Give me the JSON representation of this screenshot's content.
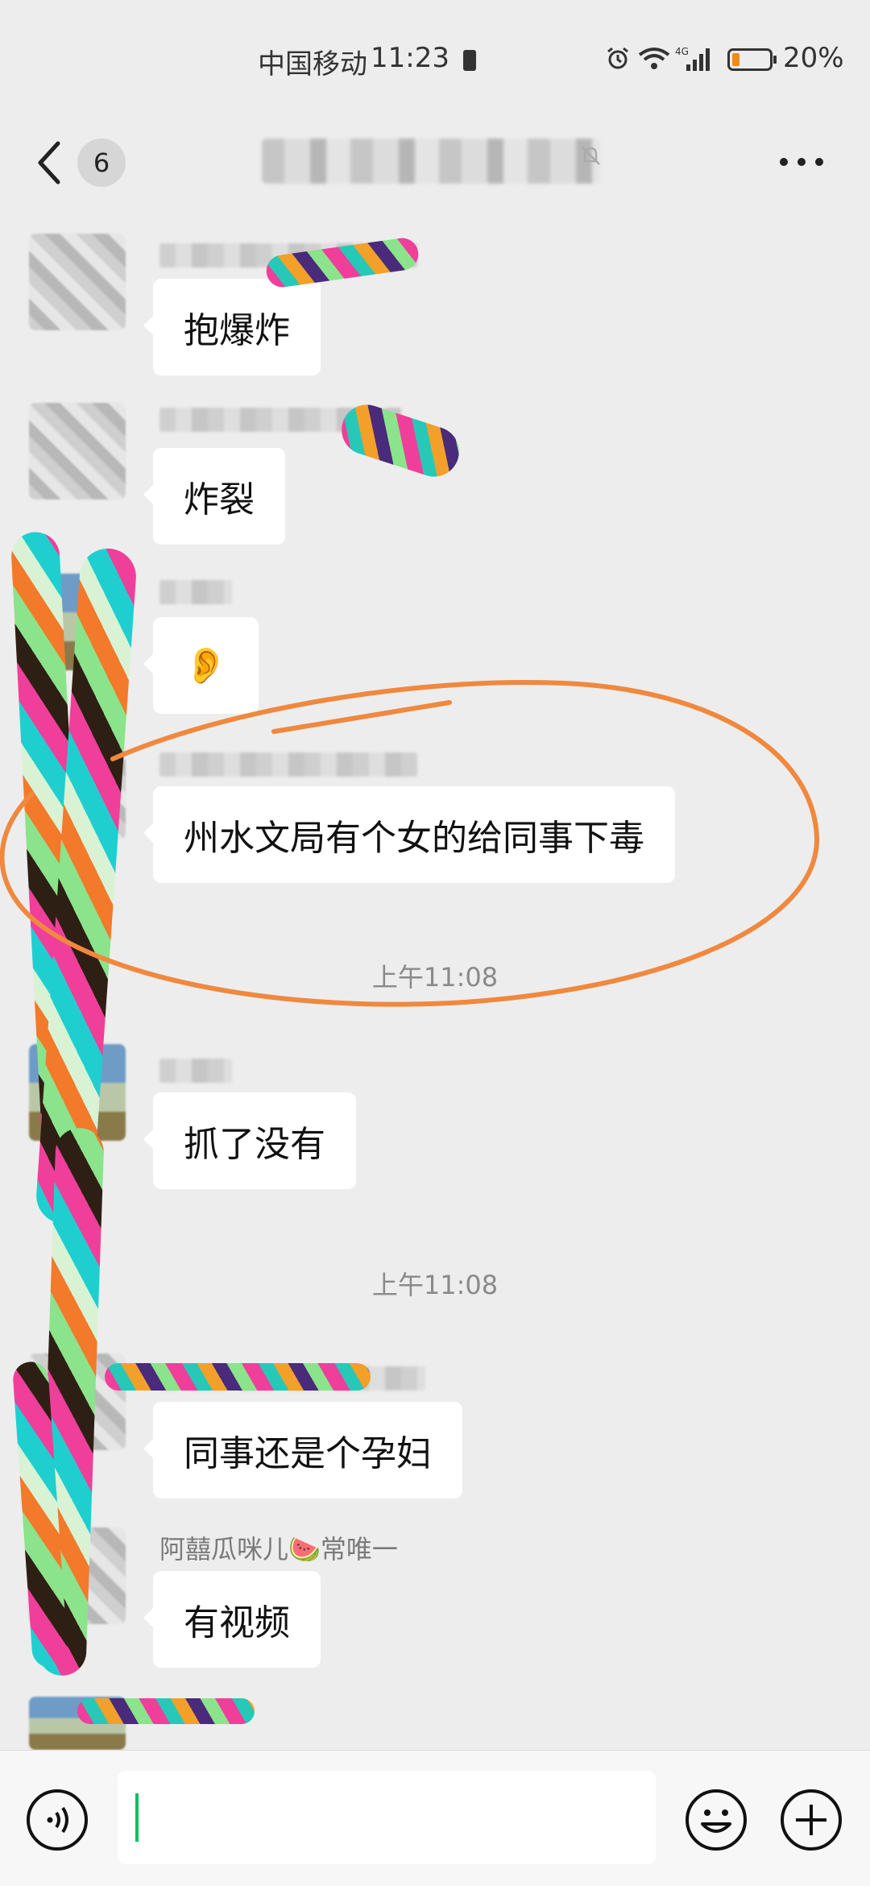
{
  "status_bar": {
    "carrier": "中国移动",
    "time": "11:23",
    "network": "4G",
    "battery_percent": "20%",
    "battery_level": 0.2
  },
  "header": {
    "back_badge": "6",
    "icons": [
      "back-icon",
      "mute-icon",
      "more-icon"
    ]
  },
  "messages": [
    {
      "text": "抱爆炸"
    },
    {
      "text": "炸裂"
    },
    {
      "text": "👂"
    },
    {
      "text": "州水文局有个女的给同事下毒"
    },
    {
      "text": "抓了没有"
    },
    {
      "text": "同事还是个孕妇"
    },
    {
      "text": "有视频",
      "sender": "阿囍瓜咪儿🍉常唯一"
    }
  ],
  "timestamps": [
    "上午11:08",
    "上午11:08"
  ],
  "input_bar": {
    "icons": [
      "voice-icon",
      "emoji-icon",
      "plus-icon"
    ],
    "placeholder": ""
  },
  "colors": {
    "background": "#ededed",
    "bubble": "#ffffff",
    "annotation_circle": "#f0883e",
    "caret": "#07c160"
  }
}
